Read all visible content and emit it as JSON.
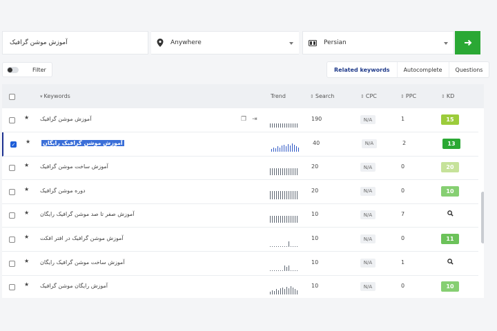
{
  "search": {
    "keyword": "آموزش موشن گرافیک",
    "location": "Anywhere",
    "language": "Persian",
    "go_icon": "arrow-right-icon"
  },
  "filter": {
    "label": "Filter"
  },
  "tabs": [
    "Related keywords",
    "Autocomplete",
    "Questions"
  ],
  "columns": {
    "keywords": "Keywords",
    "trend": "Trend",
    "search": "Search",
    "cpc": "CPC",
    "ppc": "PPC",
    "kd": "KD"
  },
  "colors": {
    "green_btn": "#2aa834",
    "kd_15": "#9ccc3b",
    "kd_13": "#2aa834",
    "kd_20": "#c6e29a",
    "kd_10": "#86cf72",
    "kd_11": "#6cc25a"
  },
  "rows": [
    {
      "keyword": "آموزش موشن گرافیک",
      "search": "190",
      "cpc": "N/A",
      "ppc": "1",
      "kd": "15",
      "checked": false,
      "trend": [
        6,
        6,
        6,
        6,
        6,
        6,
        6,
        6,
        6,
        6,
        6,
        6,
        6,
        6
      ],
      "icons": [
        "copy-icon",
        "share-icon"
      ]
    },
    {
      "keyword": "آموزش موشن گرافیک رایگان",
      "search": "40",
      "cpc": "N/A",
      "ppc": "2",
      "kd": "13",
      "checked": true,
      "trend": [
        4,
        6,
        5,
        8,
        6,
        9,
        10,
        8,
        11,
        9,
        12,
        10,
        8,
        6
      ]
    },
    {
      "keyword": "آموزش ساخت موشن گرافیک",
      "search": "20",
      "cpc": "N/A",
      "ppc": "0",
      "kd": "20",
      "checked": false,
      "trend": [
        10,
        10,
        10,
        10,
        10,
        10,
        10,
        10,
        10,
        10,
        10,
        10,
        10,
        10
      ]
    },
    {
      "keyword": "دوره موشن گرافیک",
      "search": "20",
      "cpc": "N/A",
      "ppc": "0",
      "kd": "10",
      "checked": false,
      "trend": [
        12,
        12,
        12,
        12,
        12,
        12,
        12,
        12,
        12,
        12,
        12,
        12,
        12,
        12
      ]
    },
    {
      "keyword": "آموزش صفر تا صد موشن گرافیک رایگان",
      "search": "10",
      "cpc": "N/A",
      "ppc": "7",
      "kd": "",
      "checked": false,
      "trend": [
        10,
        10,
        10,
        10,
        10,
        10,
        10,
        10,
        10,
        10,
        10,
        10,
        10,
        10
      ]
    },
    {
      "keyword": "آموزش موشن گرافیک در افتر افکت",
      "search": "10",
      "cpc": "N/A",
      "ppc": "0",
      "kd": "11",
      "checked": false,
      "trend": [
        1,
        1,
        1,
        1,
        1,
        1,
        1,
        1,
        1,
        8,
        1,
        1,
        1,
        1
      ]
    },
    {
      "keyword": "آموزش ساخت موشن گرافیک رایگان",
      "search": "10",
      "cpc": "N/A",
      "ppc": "1",
      "kd": "",
      "checked": false,
      "trend": [
        1,
        1,
        1,
        1,
        1,
        1,
        1,
        8,
        6,
        8,
        1,
        1,
        1,
        1
      ]
    },
    {
      "keyword": "آموزش رایگان موشن گرافیک",
      "search": "10",
      "cpc": "N/A",
      "ppc": "0",
      "kd": "10",
      "checked": false,
      "trend": [
        4,
        6,
        5,
        8,
        6,
        9,
        10,
        8,
        11,
        9,
        12,
        10,
        8,
        6
      ]
    }
  ]
}
